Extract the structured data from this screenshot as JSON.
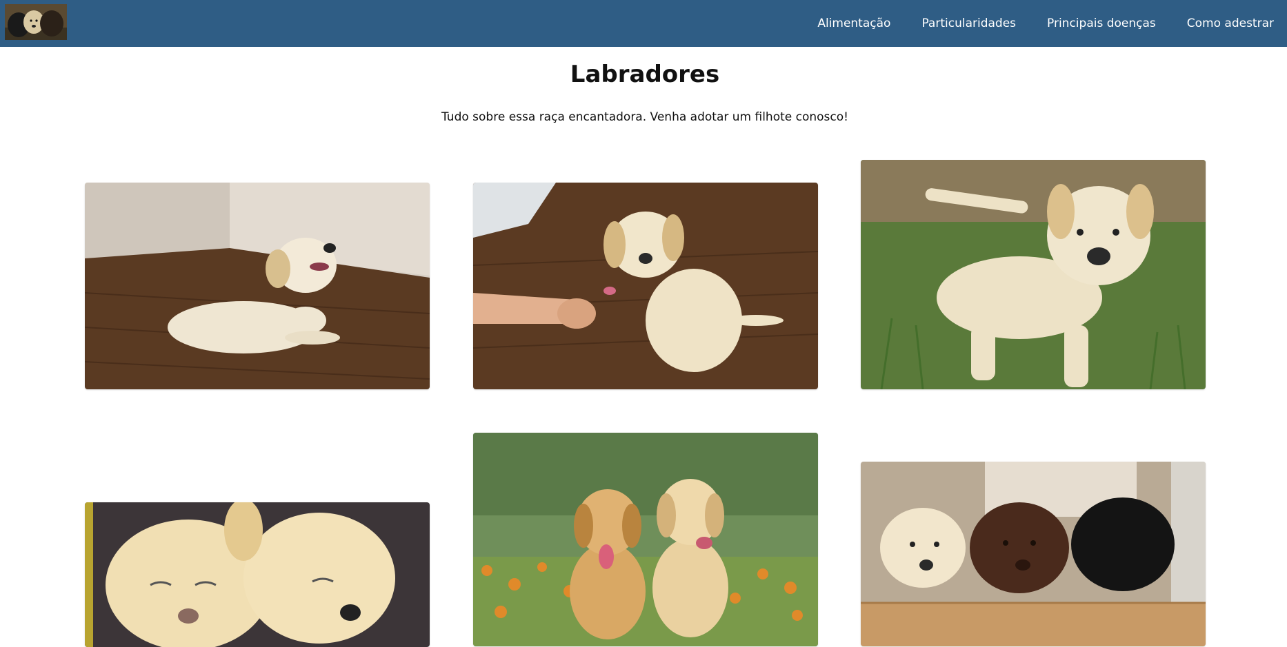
{
  "navbar": {
    "logo_alt": "labrador-puppies-logo",
    "links": [
      {
        "label": "Alimentação"
      },
      {
        "label": "Particularidades"
      },
      {
        "label": "Principais doenças"
      },
      {
        "label": "Como adestrar"
      }
    ]
  },
  "header": {
    "title": "Labradores",
    "subtitle": "Tudo sobre essa raça encantadora. Venha adotar um filhote conosco!"
  },
  "gallery": [
    {
      "subject": "yellow labrador puppy lying on wooden floor"
    },
    {
      "subject": "yellow labrador puppy giving paw to a hand"
    },
    {
      "subject": "yellow labrador puppy standing on grass"
    },
    {
      "subject": "two yellow labrador puppies held together"
    },
    {
      "subject": "two golden puppies sitting in flower field"
    },
    {
      "subject": "yellow, chocolate and black labrador puppies in a box"
    }
  ],
  "colors": {
    "navbar": "#2f5d85",
    "nav_text": "#ffffff",
    "page_background": "#ffffff"
  }
}
